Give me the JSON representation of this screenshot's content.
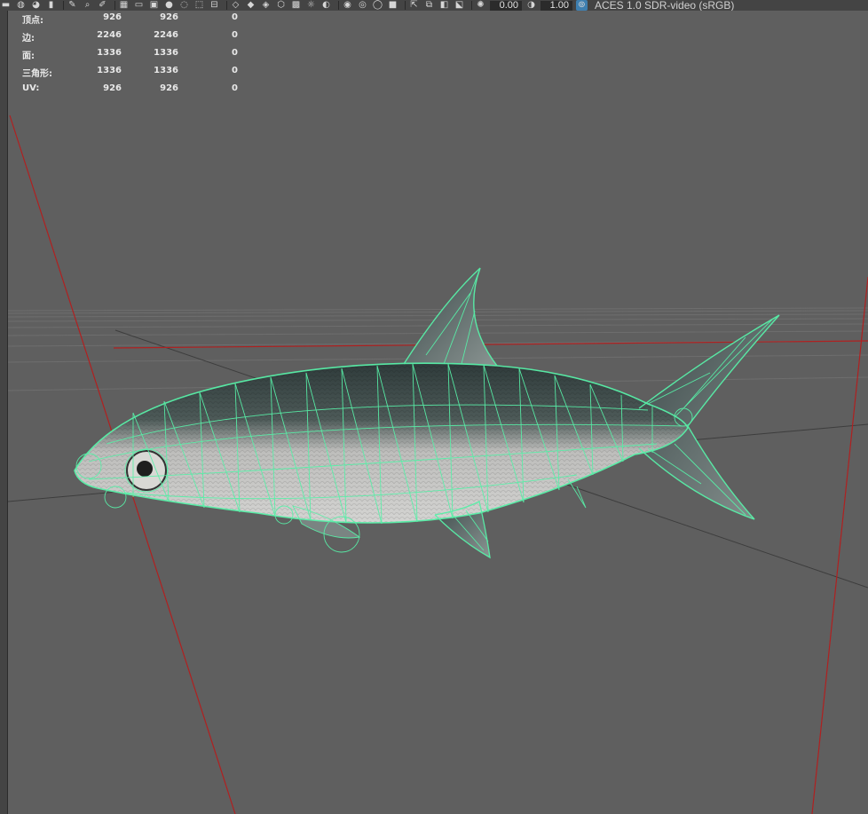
{
  "toolbar": {
    "exposure_value": "0.00",
    "gamma_value": "1.00",
    "color_space": "ACES 1.0 SDR-video (sRGB)",
    "icons": [
      "camera-icon",
      "camera-lock-icon",
      "bookmark-icon",
      "grid-icon",
      "film-gate-icon",
      "wireframe-icon",
      "smooth-shade-icon",
      "texture-icon",
      "light-icon",
      "shadow-icon",
      "isolate-icon",
      "xray-icon",
      "exposure-icon",
      "gamma-icon",
      "color-management-icon"
    ]
  },
  "hud": {
    "rows": [
      {
        "label": "顶点:",
        "v1": "926",
        "v2": "926",
        "v3": "0"
      },
      {
        "label": "边:",
        "v1": "2246",
        "v2": "2246",
        "v3": "0"
      },
      {
        "label": "面:",
        "v1": "1336",
        "v2": "1336",
        "v3": "0"
      },
      {
        "label": "三角形:",
        "v1": "1336",
        "v2": "1336",
        "v3": "0"
      },
      {
        "label": "UV:",
        "v1": "926",
        "v2": "926",
        "v3": "0"
      }
    ]
  },
  "colors": {
    "background": "#5f5f5f",
    "toolbar": "#444444",
    "grid": "#6e6e6e",
    "axis_red": "#b02020",
    "wire": "#58f0a8",
    "fish_back": "#3c4a4a",
    "fish_belly": "#c6c6c4"
  }
}
